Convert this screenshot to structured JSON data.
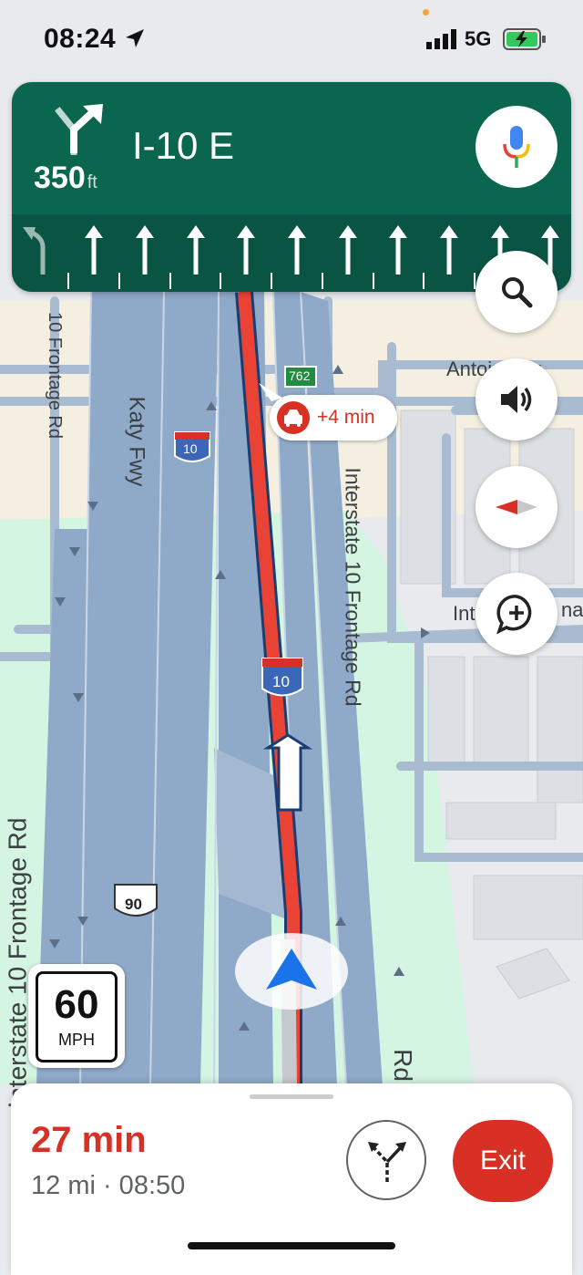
{
  "status_bar": {
    "time": "08:24",
    "network": "5G"
  },
  "nav_banner": {
    "distance": "350",
    "distance_unit": "ft",
    "road": "I-10 E",
    "bg_color": "#0b6650"
  },
  "map": {
    "labels": {
      "frontage_left": "10 Frontage Rd",
      "katy_fwy": "Katy Fwy",
      "interstate_frontage_right": "Interstate 10 Frontage Rd",
      "interstate_frontage_left": "Interstate 10 Frontage Rd",
      "antoine": "Antoine Dr",
      "rd_bottom": "Rd",
      "inter": "Int",
      "na": "na"
    },
    "shields": {
      "i10_top": "10",
      "i10_mid": "10",
      "us90": "90",
      "exit762": "762"
    }
  },
  "traffic": {
    "delay": "+4 min"
  },
  "speed_limit": {
    "value": "60",
    "unit": "MPH"
  },
  "eta": {
    "duration": "27 min",
    "details": "12 mi · 08:50"
  },
  "buttons": {
    "exit": "Exit"
  },
  "colors": {
    "route": "#ea4335",
    "accent_red": "#d93025",
    "highway": "#8fa9c9"
  }
}
